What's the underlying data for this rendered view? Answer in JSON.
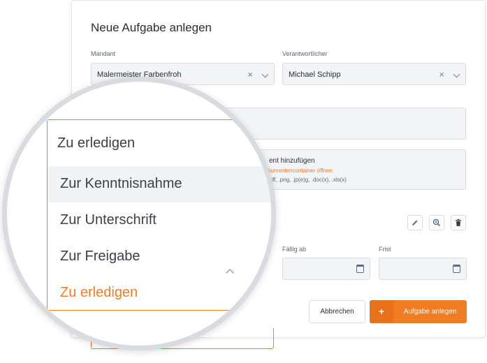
{
  "dialog": {
    "title": "Neue Aufgabe anlegen",
    "mandant": {
      "label": "Mandant",
      "value": "Malermeister Farbenfroh"
    },
    "verantwortlicher": {
      "label": "Verantwortlicher",
      "value": "Michael Schipp"
    },
    "attachment": {
      "title": "ent hinzufügen",
      "link": "okumentencontainer öffnen",
      "formats": "pdf, .png, .jp(e)g, .doc(x), .xls(x)"
    },
    "faellig_ab": {
      "label": "Fällig ab",
      "value": ""
    },
    "frist": {
      "label": "Frist",
      "value": ""
    },
    "buttons": {
      "cancel": "Abbrechen",
      "create": "Aufgabe anlegen",
      "plus": "+"
    },
    "clear_glyph": "×"
  },
  "dropdown": {
    "selected": "Zu erledigen",
    "options": [
      "Zur Kenntnisnahme",
      "Zur Unterschrift",
      "Zur Freigabe",
      "Zu erledigen"
    ]
  },
  "colors": {
    "accent": "#f07d22",
    "field_bg": "#f3f4f6",
    "border": "#d9dde2",
    "icon": "#5a6b8c"
  },
  "icons": [
    "pencil-icon",
    "zoom-in-icon",
    "trash-icon",
    "calendar-icon",
    "chevron-down-icon",
    "clear-icon"
  ]
}
